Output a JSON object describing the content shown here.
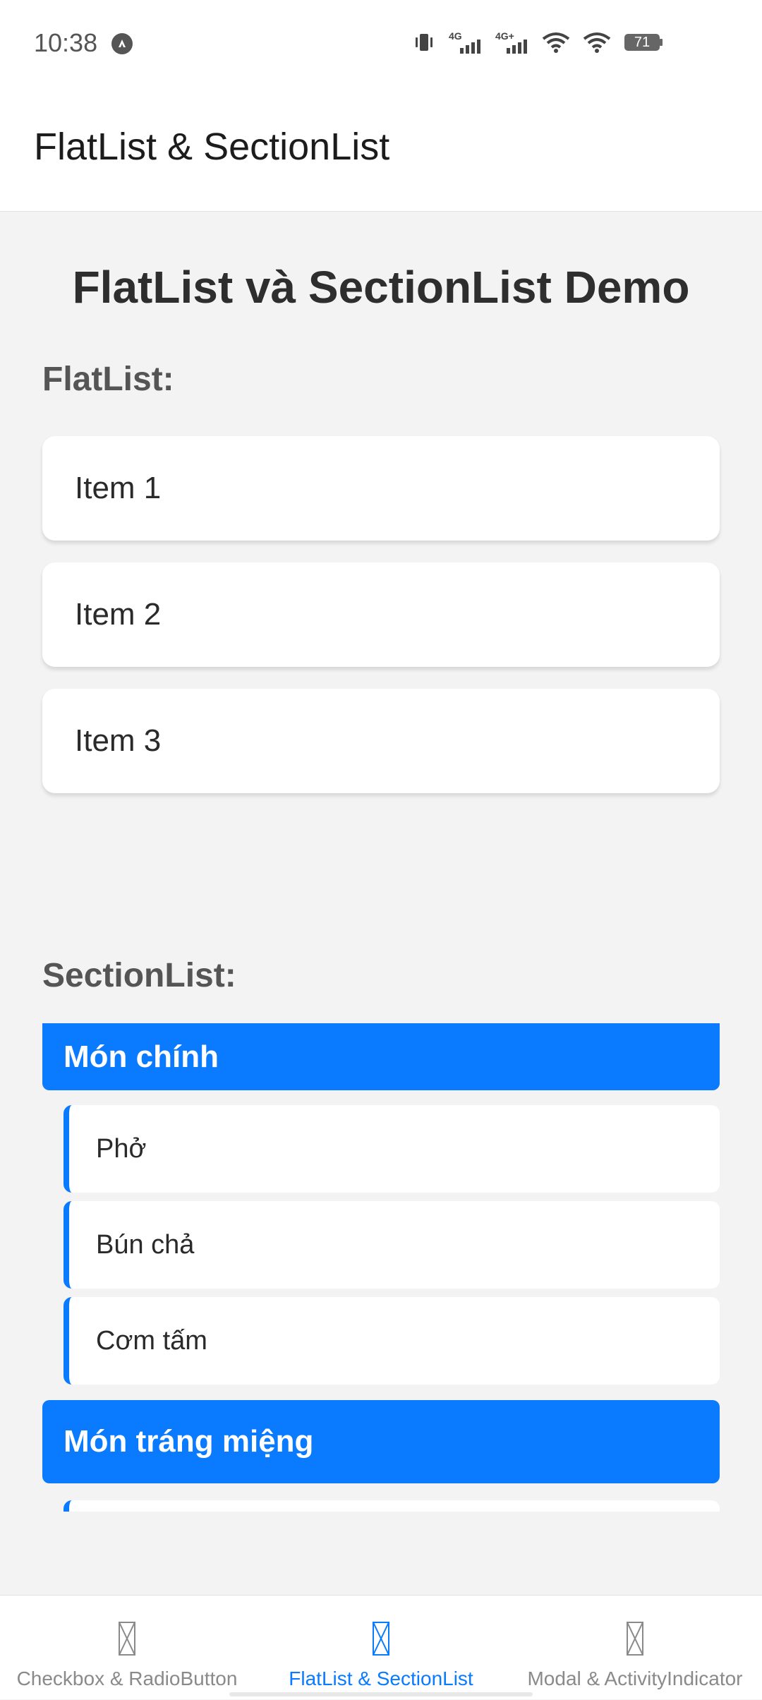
{
  "status_bar": {
    "time": "10:38",
    "battery": "71",
    "icons": [
      "app-notification-icon",
      "vibrate-icon",
      "signal-4g-icon",
      "signal-4g-plus-icon",
      "wifi-icon",
      "wifi-icon",
      "battery-icon"
    ]
  },
  "app_bar": {
    "title": "FlatList & SectionList"
  },
  "main": {
    "heading": "FlatList và SectionList Demo",
    "flatlist_label": "FlatList:",
    "flatlist_items": [
      "Item 1",
      "Item 2",
      "Item 3"
    ],
    "sectionlist_label": "SectionList:",
    "sections": [
      {
        "title": "Món chính",
        "items": [
          "Phở",
          "Bún chả",
          "Cơm tấm"
        ]
      },
      {
        "title": "Món tráng miệng",
        "items": [
          ""
        ]
      }
    ]
  },
  "tab_bar": {
    "tabs": [
      {
        "label": "Checkbox & RadioButton",
        "icon": "missing-glyph-icon",
        "active": false
      },
      {
        "label": "FlatList & SectionList",
        "icon": "missing-glyph-icon",
        "active": true
      },
      {
        "label": "Modal & ActivityIndicator",
        "icon": "missing-glyph-icon",
        "active": false
      }
    ]
  },
  "colors": {
    "accent": "#0a7aff",
    "background": "#f3f3f3",
    "card": "#ffffff",
    "inactive_tab": "#8a8a8a"
  }
}
